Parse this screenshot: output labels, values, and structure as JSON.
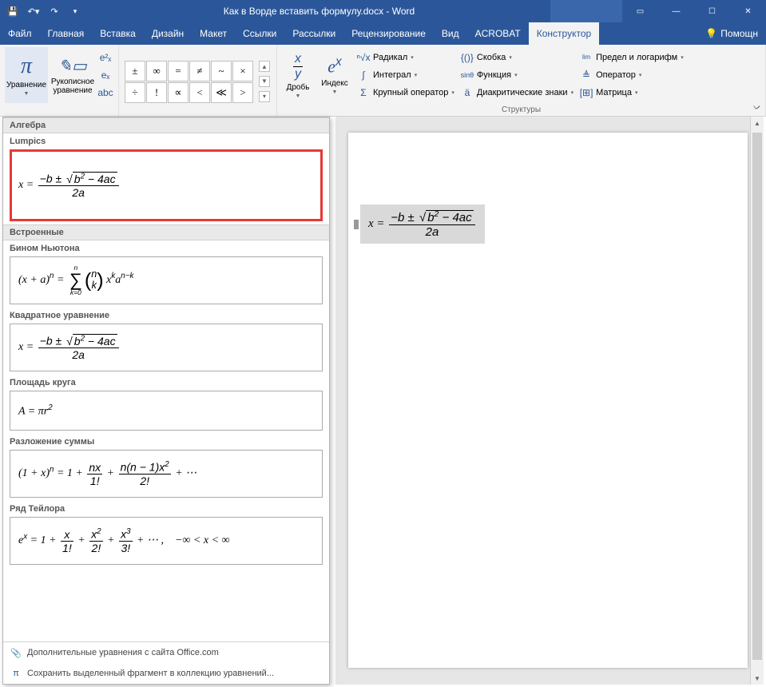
{
  "titlebar": {
    "title": "Как в Ворде вставить формулу.docx - Word"
  },
  "menu": {
    "tabs": [
      "Файл",
      "Главная",
      "Вставка",
      "Дизайн",
      "Макет",
      "Ссылки",
      "Рассылки",
      "Рецензирование",
      "Вид",
      "ACROBAT",
      "Конструктор"
    ],
    "help": "Помощн"
  },
  "ribbon": {
    "equation": {
      "label": "Уравнение"
    },
    "ink": {
      "label": "Рукописное\nуравнение"
    },
    "tools_col": [
      "e²ₓ",
      "eₓ",
      "abc"
    ],
    "symbols": [
      "±",
      "∞",
      "=",
      "≠",
      "~",
      "×",
      "÷",
      "!",
      "∝",
      "<",
      "≪",
      ">"
    ],
    "fraction": "Дробь",
    "index": "Индекс",
    "radical": "Радикал",
    "integral": "Интеграл",
    "large_op": "Крупный оператор",
    "bracket": "Скобка",
    "function": "Функция",
    "diacritical": "Диакритические знаки",
    "limits": "Предел и логарифм",
    "operator": "Оператор",
    "matrix": "Матрица",
    "structures_label": "Структуры"
  },
  "gallery": {
    "cat_algebra": "Алгебра",
    "lumpics_title": "Lumpics",
    "cat_builtin": "Встроенные",
    "binomial_title": "Бином Ньютона",
    "quadratic_title": "Квадратное уравнение",
    "circle_area_title": "Площадь круга",
    "sum_expansion_title": "Разложение суммы",
    "taylor_title": "Ряд Тейлора",
    "footer_more": "Дополнительные уравнения с сайта Office.com",
    "footer_save": "Сохранить выделенный фрагмент в коллекцию уравнений..."
  }
}
